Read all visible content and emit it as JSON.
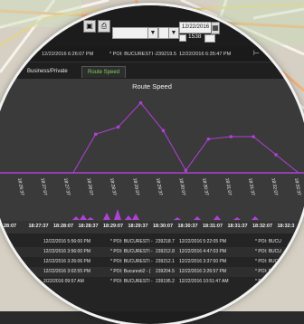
{
  "toolbar": {
    "date_value": "12/22/2016 1",
    "checkbox_label": "1538",
    "buttons": [
      "save",
      "print",
      "calendar"
    ]
  },
  "record_strip": {
    "timestamp": "12/22/2016 6:26:07 PM",
    "location": "* POI: BUCURESTI -",
    "code": "239219.5",
    "end_time": "12/22/2016 6:35:47 PM"
  },
  "tabs": [
    {
      "label": "Business/Private",
      "active": false
    },
    {
      "label": "Route Speed",
      "active": true
    }
  ],
  "chart_data": {
    "type": "line",
    "title": "Route Speed",
    "x": [
      "18:26:37",
      "18:27:07",
      "18:27:37",
      "18:28:07",
      "18:28:37",
      "18:29:07",
      "18:29:37",
      "18:30:07",
      "18:30:37",
      "18:31:07",
      "18:31:37",
      "18:32:07",
      "18:32:37"
    ],
    "series": [
      {
        "values": [
          0,
          0,
          0,
          0,
          32,
          38,
          58,
          35,
          2,
          28,
          30,
          30,
          15,
          0
        ]
      }
    ],
    "line_color": "#b040d8",
    "baseline_color": "#b040d8"
  },
  "timeline": {
    "labels": [
      "28:07",
      "18:27:37",
      "18:28:07",
      "18:28:37",
      "18:29:07",
      "18:29:37",
      "18:30:07",
      "18:30:37",
      "18:31:07",
      "18:31:37",
      "18:32:07",
      "18:32:3"
    ]
  },
  "table": {
    "rows": [
      [
        "12/22/2016 5:56:00 PM",
        "* POI: BUCURESTI -",
        "239218.7",
        "12/22/2016 5:22:05 PM",
        "* POI: BUCU"
      ],
      [
        "12/22/2016 3:56:00 PM",
        "* POI: BUCURESTI -",
        "239212.8",
        "12/22/2016 4:47:03 PM",
        "* POI: BUCU"
      ],
      [
        "12/22/2016 3:26:06 PM",
        "* POI: BUCURESTI -",
        "239212.1",
        "12/22/2016 3:37:50 PM",
        "* POI: BUCU"
      ],
      [
        "12/22/2016 3:02:55 PM",
        "* POI: Bucuresti2 - (",
        "239204.5",
        "12/22/2016 3:26:57 PM",
        "* POI: BUCU"
      ],
      [
        "2/22/2016 09:57 AM",
        "* POI: BUCURESTI -",
        "239195.2",
        "12/22/2016 10:51:47 AM",
        "* POI: BUCU"
      ]
    ]
  }
}
